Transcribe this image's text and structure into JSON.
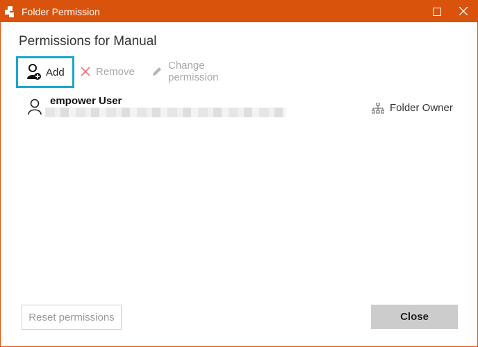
{
  "window": {
    "title": "Folder Permission",
    "accent_color": "#d9530c"
  },
  "dialog": {
    "heading": "Permissions for Manual"
  },
  "toolbar": {
    "add_label": "Add",
    "remove_label": "Remove",
    "change_label": "Change permission",
    "highlight_color": "#1aa6cf"
  },
  "users": [
    {
      "name": "empower User",
      "role": "Folder Owner"
    }
  ],
  "footer": {
    "reset_label": "Reset permissions",
    "close_label": "Close"
  }
}
